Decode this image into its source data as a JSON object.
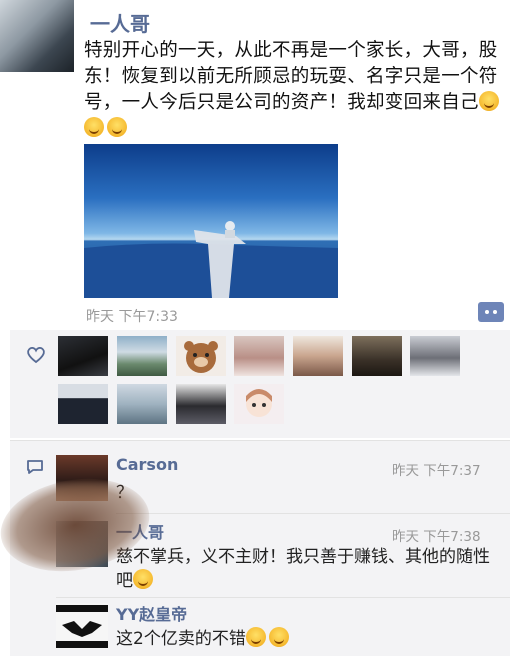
{
  "post": {
    "author": "一人哥",
    "text": "特别开心的一天，从此不再是一个家长，大哥，股东！恢复到以前无所顾忌的玩耍、名字只是一个符号，一人今后只是公司的资产！我却变回来自己",
    "emojis": [
      "grin-emoji",
      "grin-emoji",
      "grin-emoji"
    ],
    "time": "昨天 下午7:33"
  },
  "likes": {
    "count": 12,
    "avatars": [
      "man-dark",
      "landscape",
      "bear-cartoon",
      "girl-selfie",
      "girl-baby",
      "movie-poster",
      "woman-portrait",
      "man-suit",
      "lake-view",
      "anime-couple",
      "cartoon-girl"
    ]
  },
  "comments": [
    {
      "name": "Carson",
      "time": "昨天 下午7:37",
      "text": "？"
    },
    {
      "name": "一人哥",
      "time": "昨天 下午7:38",
      "text": "慈不掌兵，义不主财！我只善于赚钱、其他的随性吧"
    },
    {
      "name": "YY赵皇帝",
      "text": "这2个亿卖的不错"
    }
  ],
  "colors": {
    "name_blue": "#576b95",
    "bg_gray": "#f3f3f5"
  }
}
